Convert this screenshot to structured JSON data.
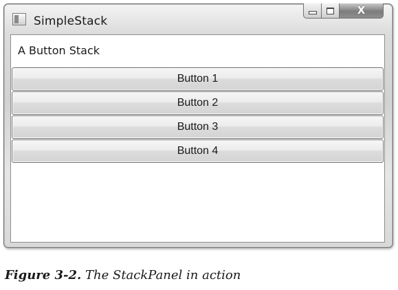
{
  "window": {
    "title": "SimpleStack",
    "icons": {
      "app": "window-app-icon",
      "minimize": "minimize-icon",
      "maximize": "maximize-icon",
      "close": "close-icon"
    },
    "close_glyph": "X"
  },
  "stack": {
    "label": "A Button Stack",
    "buttons": [
      {
        "label": "Button 1"
      },
      {
        "label": "Button 2"
      },
      {
        "label": "Button 3"
      },
      {
        "label": "Button 4"
      }
    ]
  },
  "figure": {
    "number": "Figure 3-2.",
    "caption": "The StackPanel in action"
  }
}
